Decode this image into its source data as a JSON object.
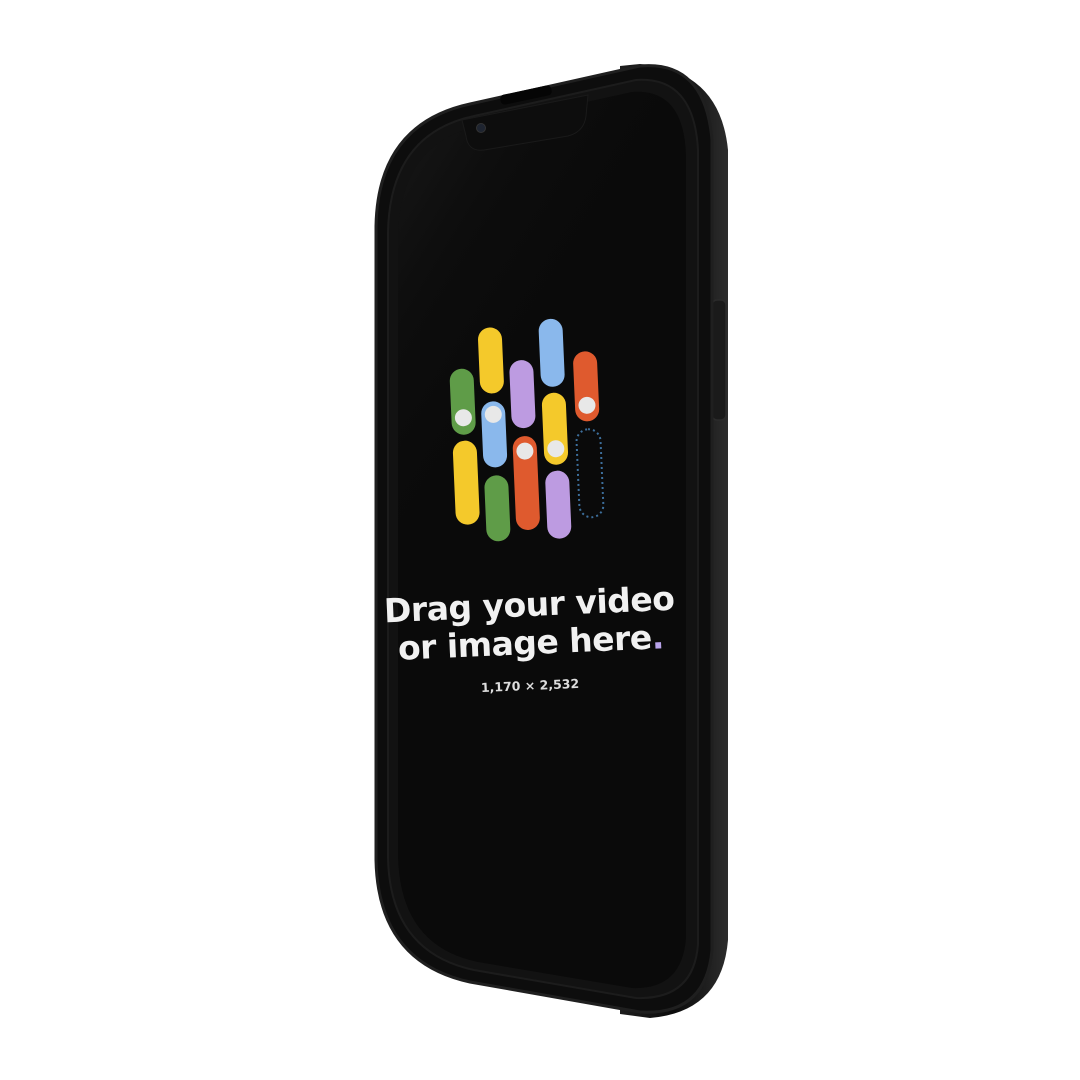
{
  "prompt": {
    "line1": "Drag your video",
    "line2": "or image here",
    "period": ".",
    "dimensions": "1,170 × 2,532"
  },
  "logo": {
    "icon": "pill-toggle-cluster-icon",
    "colors": {
      "green": "#5f9c48",
      "yellow": "#f4c92b",
      "blue": "#8ab8ec",
      "purple": "#bd9be1",
      "orange": "#df5a2e",
      "knob": "#e8e8e8",
      "dotted_outline": "#3d6f9c"
    }
  },
  "device": {
    "body_color": "#0d0d0d",
    "screen_color": "#0a0a0a",
    "frame_color": "#1b1b1b"
  }
}
